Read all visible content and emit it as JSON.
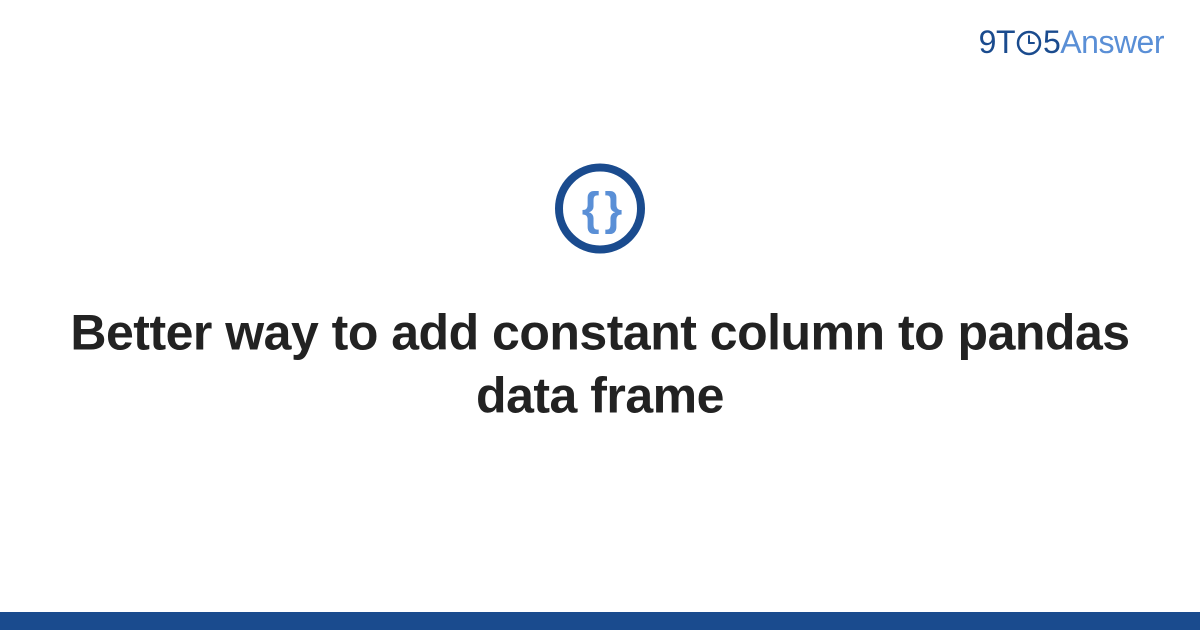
{
  "brand": {
    "prefix": "9T",
    "middle": "5",
    "suffix": "Answer"
  },
  "icon": {
    "name": "code-braces",
    "glyph": "{ }"
  },
  "title": "Better way to add constant column to pandas data frame",
  "colors": {
    "primary": "#1a4b8e",
    "accent": "#5a8fd6",
    "text": "#222222"
  }
}
